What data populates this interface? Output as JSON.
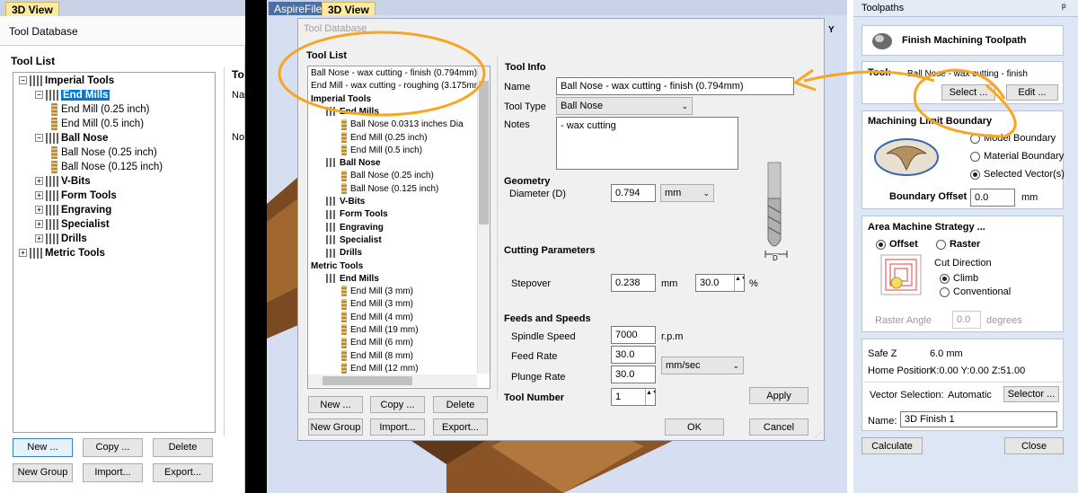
{
  "left": {
    "tab": "3D View",
    "header": "Tool Database",
    "tool_list_label": "Tool List",
    "partial_label": "To",
    "partial_name": "Nar",
    "partial_notes": "No",
    "tree": [
      {
        "label": "Imperial Tools",
        "kind": "group",
        "level": 0,
        "pm": "−"
      },
      {
        "label": "End Mills",
        "kind": "group",
        "level": 1,
        "pm": "−",
        "selected": true
      },
      {
        "label": "End Mill (0.25 inch)",
        "kind": "tool",
        "level": 2
      },
      {
        "label": "End Mill (0.5 inch)",
        "kind": "tool",
        "level": 2
      },
      {
        "label": "Ball Nose",
        "kind": "group",
        "level": 1,
        "pm": "−"
      },
      {
        "label": "Ball Nose (0.25 inch)",
        "kind": "tool",
        "level": 2
      },
      {
        "label": "Ball Nose (0.125 inch)",
        "kind": "tool",
        "level": 2
      },
      {
        "label": "V-Bits",
        "kind": "group",
        "level": 1,
        "pm": "+"
      },
      {
        "label": "Form Tools",
        "kind": "group",
        "level": 1,
        "pm": "+"
      },
      {
        "label": "Engraving",
        "kind": "group",
        "level": 1,
        "pm": "+"
      },
      {
        "label": "Specialist",
        "kind": "group",
        "level": 1,
        "pm": "+"
      },
      {
        "label": "Drills",
        "kind": "group",
        "level": 1,
        "pm": "+"
      },
      {
        "label": "Metric Tools",
        "kind": "group",
        "level": 0,
        "pm": "+"
      }
    ],
    "buttons": {
      "new": "New ...",
      "copy": "Copy ...",
      "delete": "Delete",
      "new_group": "New Group",
      "import": "Import...",
      "export": "Export..."
    }
  },
  "mid": {
    "tab_file": "AspireFile",
    "tab_3d": "3D View",
    "axis_y": "Y"
  },
  "dialog": {
    "title": "Tool Database",
    "tool_list_label": "Tool List",
    "list": [
      {
        "label": "Ball Nose - wax cutting - finish (0.794mm)",
        "kind": "plain",
        "level": 0
      },
      {
        "label": "End Mill - wax cutting - roughing (3.175mm)",
        "kind": "plain",
        "level": 0
      },
      {
        "label": "Imperial Tools",
        "kind": "header",
        "level": 0
      },
      {
        "label": "End Mills",
        "kind": "group",
        "level": 1
      },
      {
        "label": "Ball Nose 0.0313 inches Dia",
        "kind": "tool",
        "level": 2
      },
      {
        "label": "End Mill (0.25 inch)",
        "kind": "tool",
        "level": 2
      },
      {
        "label": "End Mill (0.5 inch)",
        "kind": "tool",
        "level": 2
      },
      {
        "label": "Ball Nose",
        "kind": "group",
        "level": 1
      },
      {
        "label": "Ball Nose (0.25 inch)",
        "kind": "tool",
        "level": 2
      },
      {
        "label": "Ball Nose (0.125 inch)",
        "kind": "tool",
        "level": 2
      },
      {
        "label": "V-Bits",
        "kind": "group",
        "level": 1
      },
      {
        "label": "Form Tools",
        "kind": "group",
        "level": 1
      },
      {
        "label": "Engraving",
        "kind": "group",
        "level": 1
      },
      {
        "label": "Specialist",
        "kind": "group",
        "level": 1
      },
      {
        "label": "Drills",
        "kind": "group",
        "level": 1
      },
      {
        "label": "Metric Tools",
        "kind": "header",
        "level": 0
      },
      {
        "label": "End Mills",
        "kind": "group",
        "level": 1
      },
      {
        "label": "End Mill (3 mm)",
        "kind": "tool",
        "level": 2
      },
      {
        "label": "End Mill (3 mm)",
        "kind": "tool",
        "level": 2
      },
      {
        "label": "End Mill (4 mm)",
        "kind": "tool",
        "level": 2
      },
      {
        "label": "End Mill (19 mm)",
        "kind": "tool",
        "level": 2
      },
      {
        "label": "End Mill (6 mm)",
        "kind": "tool",
        "level": 2
      },
      {
        "label": "End Mill (8 mm)",
        "kind": "tool",
        "level": 2
      },
      {
        "label": "End Mill (12 mm)",
        "kind": "tool",
        "level": 2
      }
    ],
    "list_buttons": {
      "new": "New ...",
      "copy": "Copy ...",
      "delete": "Delete",
      "new_group": "New Group",
      "import": "Import...",
      "export": "Export..."
    },
    "tool_info": {
      "heading": "Tool Info",
      "name_label": "Name",
      "name_value": "Ball Nose - wax cutting - finish (0.794mm)",
      "type_label": "Tool Type",
      "type_value": "Ball Nose",
      "notes_label": "Notes",
      "notes_value": "- wax cutting"
    },
    "geometry": {
      "heading": "Geometry",
      "diameter_label": "Diameter (D)",
      "diameter_value": "0.794",
      "unit_value": "mm",
      "d_label": "D"
    },
    "cutting": {
      "heading": "Cutting Parameters",
      "stepover_label": "Stepover",
      "stepover_value": "0.238",
      "stepover_unit": "mm",
      "stepover_pct": "30.0",
      "pct_sign": "%"
    },
    "feeds": {
      "heading": "Feeds and Speeds",
      "spindle_label": "Spindle Speed",
      "spindle_value": "7000",
      "spindle_unit": "r.p.m",
      "feed_label": "Feed Rate",
      "feed_value": "30.0",
      "plunge_label": "Plunge Rate",
      "plunge_value": "30.0",
      "rate_unit": "mm/sec"
    },
    "tool_number": {
      "label": "Tool Number",
      "value": "1"
    },
    "apply": "Apply",
    "ok": "OK",
    "cancel": "Cancel"
  },
  "toolpaths": {
    "title": "Toolpaths",
    "pin": "ᵖ",
    "header": "Finish Machining Toolpath",
    "tool_label": "Tool:",
    "tool_value": "Ball Nose - wax cutting - finish",
    "select": "Select ...",
    "edit": "Edit ...",
    "boundary_heading": "Machining Limit Boundary",
    "boundary_options": [
      "Model Boundary",
      "Material Boundary",
      "Selected Vector(s)"
    ],
    "boundary_selected": 2,
    "boundary_offset_label": "Boundary Offset",
    "boundary_offset_value": "0.0",
    "boundary_offset_unit": "mm",
    "strategy_heading": "Area Machine Strategy ...",
    "offset_label": "Offset",
    "raster_label": "Raster",
    "cut_direction_label": "Cut Direction",
    "climb_label": "Climb",
    "conventional_label": "Conventional",
    "raster_angle_label": "Raster Angle",
    "raster_angle_value": "0.0",
    "raster_angle_unit": "degrees",
    "safe_z_label": "Safe Z",
    "safe_z_value": "6.0 mm",
    "home_label": "Home Position",
    "home_value": "X:0.00 Y:0.00 Z:51.00",
    "vector_sel_label": "Vector Selection:",
    "vector_sel_value": "Automatic",
    "selector": "Selector ...",
    "name_label": "Name:",
    "name_value": "3D Finish 1",
    "calculate": "Calculate",
    "close": "Close"
  },
  "colors": {
    "annotation": "#f5a623",
    "selection": "#0078d7",
    "dialog_bg": "#f0f0f0",
    "panel_bg": "#dce6f4"
  }
}
